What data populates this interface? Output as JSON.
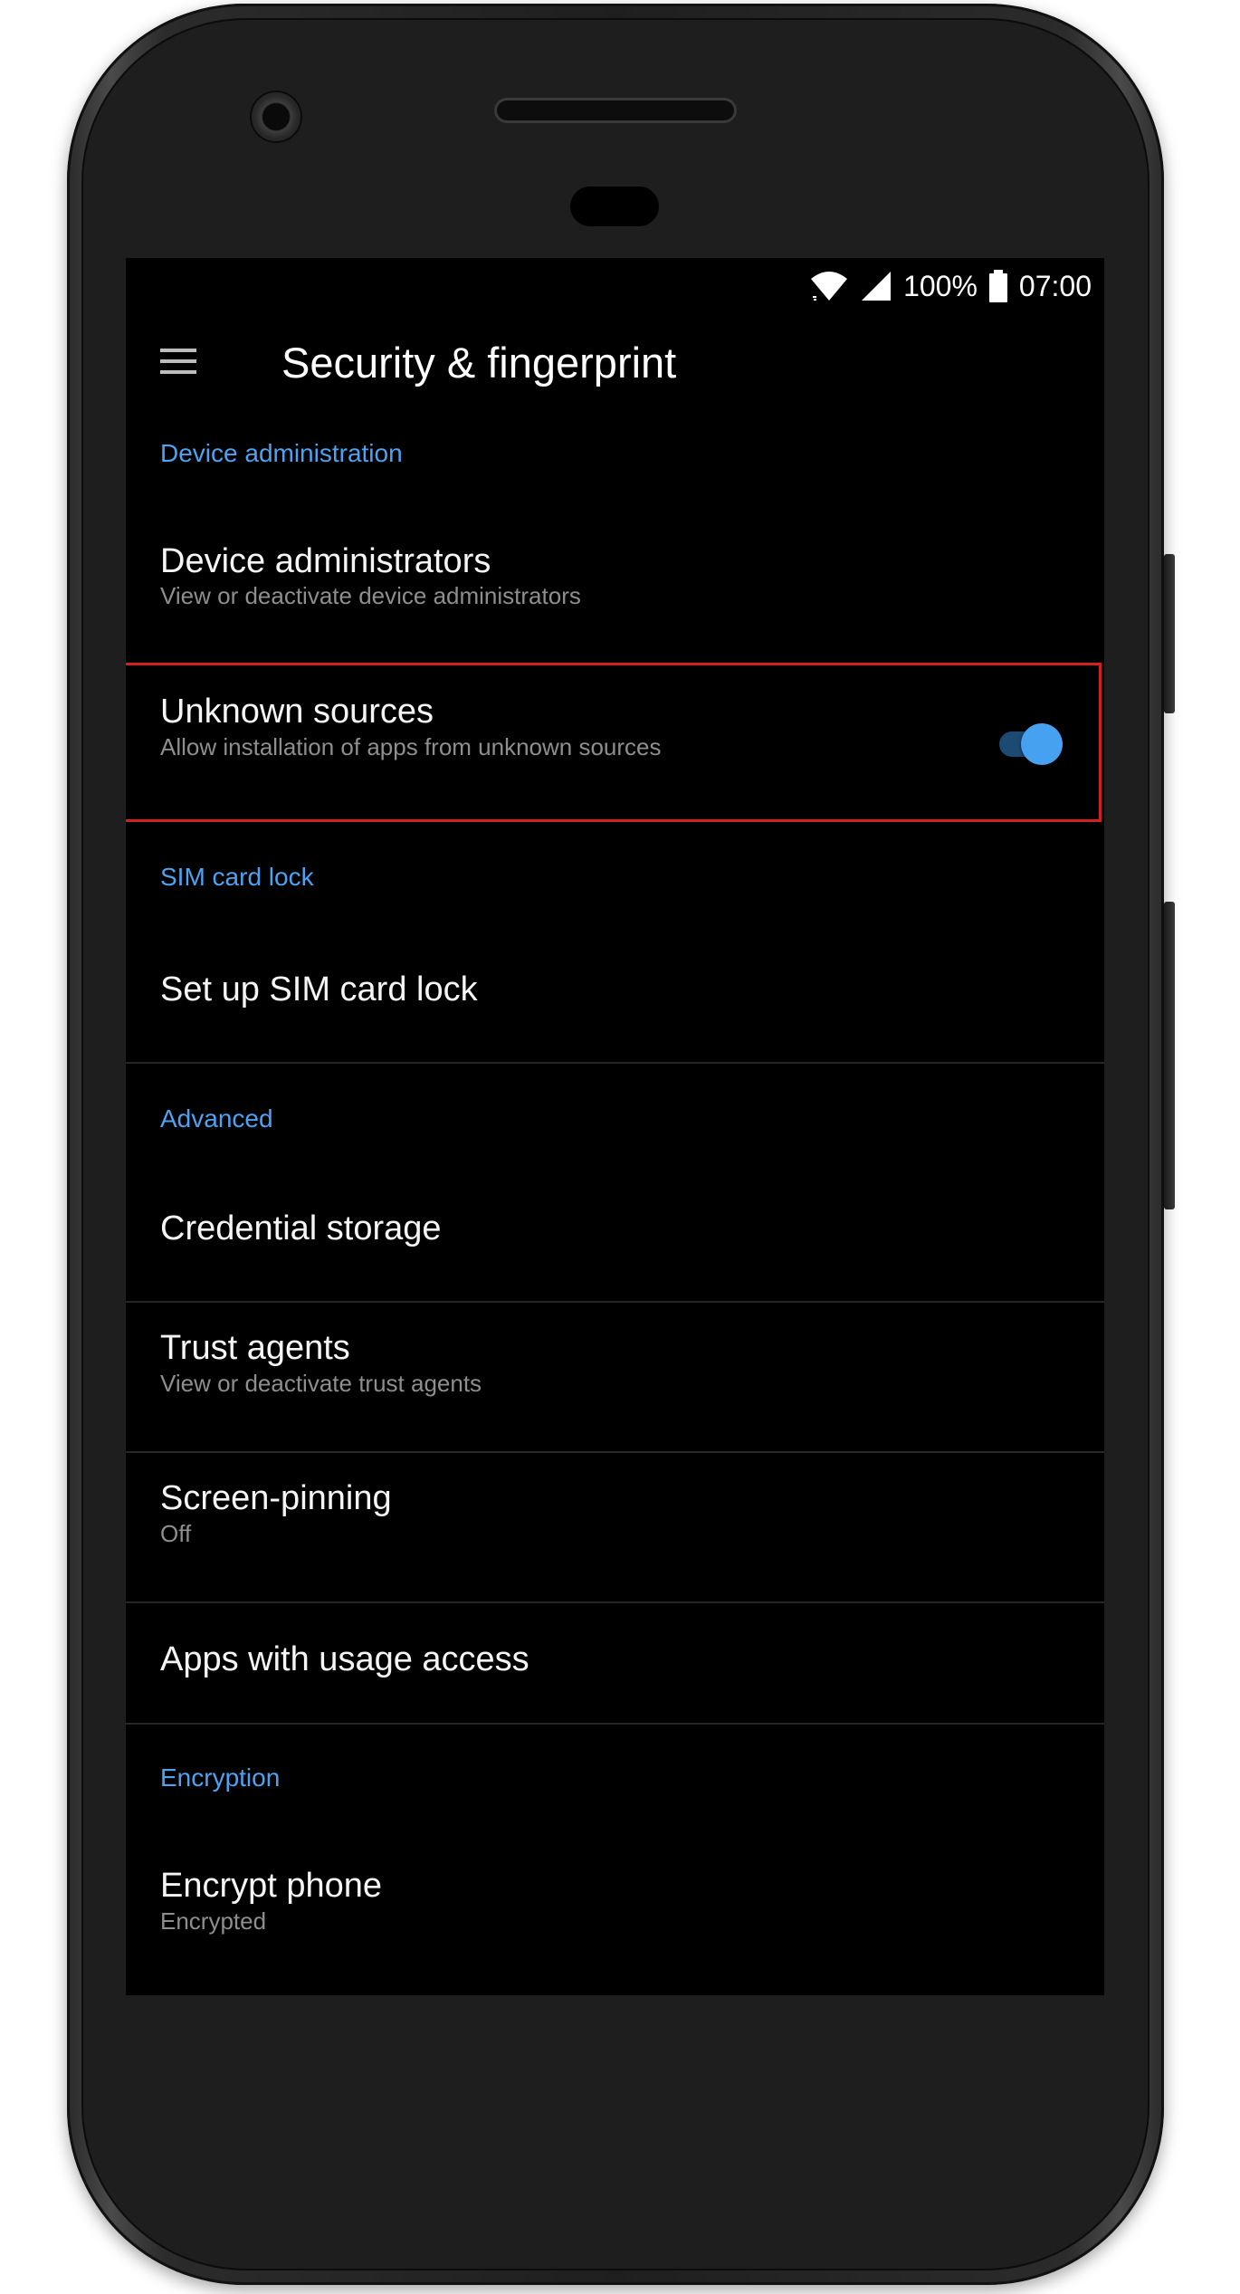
{
  "status_bar": {
    "battery_percent": "100%",
    "time": "07:00",
    "wifi_icon": "wifi-icon",
    "signal_icon": "cell-signal-icon",
    "battery_icon": "battery-full-icon"
  },
  "app_bar": {
    "menu_icon": "hamburger-menu-icon",
    "title": "Security & fingerprint"
  },
  "sections": {
    "device_administration": {
      "header": "Device administration",
      "device_administrators": {
        "title": "Device administrators",
        "summary": "View or deactivate device administrators"
      },
      "unknown_sources": {
        "title": "Unknown sources",
        "summary": "Allow installation of apps from unknown sources",
        "toggle_on": true
      }
    },
    "sim_card_lock": {
      "header": "SIM card lock",
      "set_up": {
        "title": "Set up SIM card lock"
      }
    },
    "advanced": {
      "header": "Advanced",
      "credential_storage": {
        "title": "Credential storage"
      },
      "trust_agents": {
        "title": "Trust agents",
        "summary": "View or deactivate trust agents"
      },
      "screen_pinning": {
        "title": "Screen-pinning",
        "summary": "Off"
      },
      "usage_access": {
        "title": "Apps with usage access"
      }
    },
    "encryption": {
      "header": "Encryption",
      "encrypt_phone": {
        "title": "Encrypt phone",
        "summary": "Encrypted"
      }
    }
  },
  "colors": {
    "accent": "#4ba3f2",
    "highlight_border": "#d21f1f",
    "screen_background": "#000000",
    "summary_text": "#8e8e8e"
  }
}
